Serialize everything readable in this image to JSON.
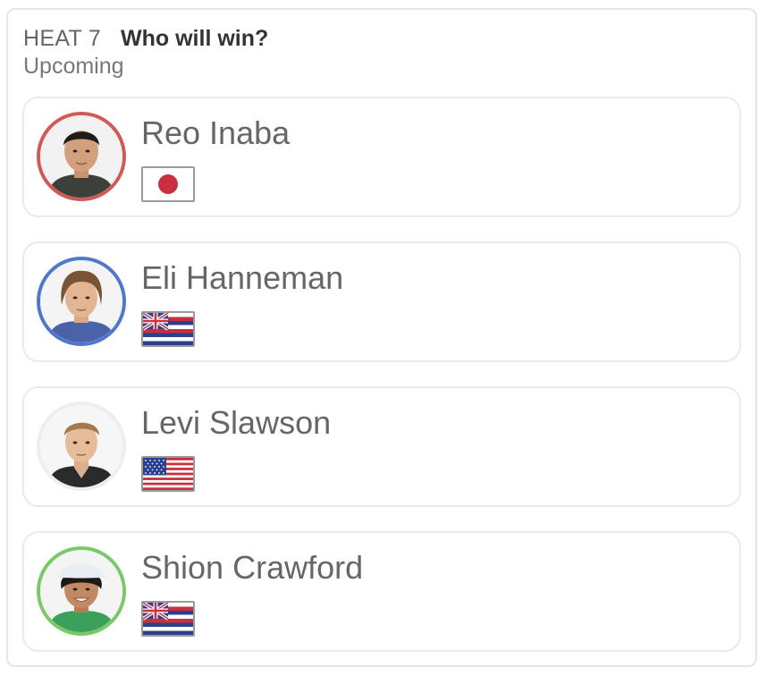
{
  "header": {
    "heat_label": "HEAT 7",
    "question": "Who will win?",
    "status": "Upcoming"
  },
  "surfers": [
    {
      "name": "Reo Inaba",
      "flag": "japan-flag-icon",
      "ring_color": "#d05a55"
    },
    {
      "name": "Eli Hanneman",
      "flag": "hawaii-flag-icon",
      "ring_color": "#4f77cc"
    },
    {
      "name": "Levi Slawson",
      "flag": "usa-flag-icon",
      "ring_color": "#eeeeee"
    },
    {
      "name": "Shion Crawford",
      "flag": "hawaii-flag-icon",
      "ring_color": "#79c969"
    }
  ]
}
